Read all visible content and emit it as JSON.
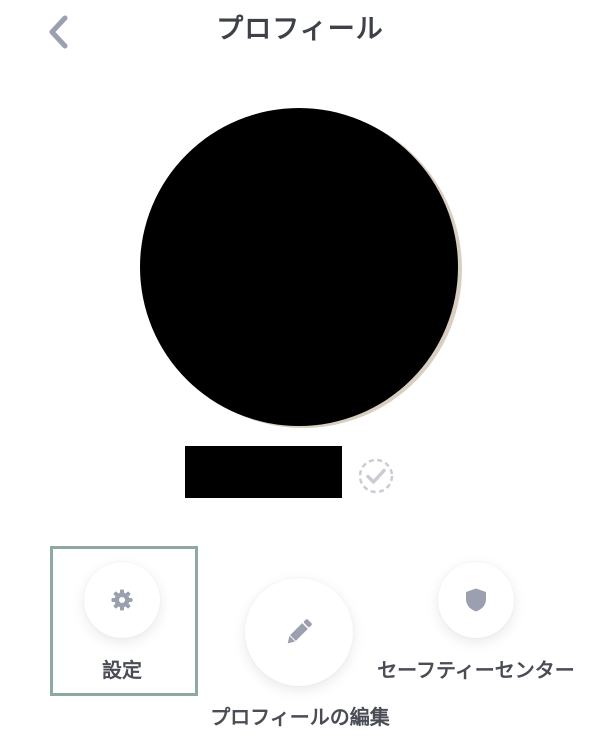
{
  "header": {
    "title": "プロフィール",
    "back_icon": "chevron-left-icon"
  },
  "profile": {
    "verified_icon": "check-badge-icon"
  },
  "actions": {
    "settings": {
      "label": "設定",
      "icon": "gear-icon"
    },
    "edit_profile": {
      "label": "プロフィールの編集",
      "icon": "pencil-icon"
    },
    "safety_center": {
      "label": "セーフティーセンター",
      "icon": "shield-icon"
    }
  },
  "colors": {
    "title_text": "#3e4148",
    "label_text": "#4a4d55",
    "icon_gray": "#9aa0ad",
    "focus_border": "#8ea9a2"
  }
}
